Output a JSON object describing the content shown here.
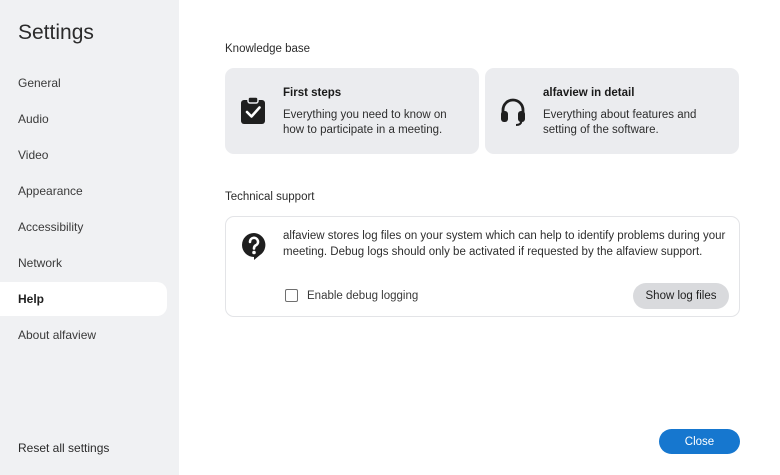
{
  "sidebar": {
    "title": "Settings",
    "items": [
      {
        "label": "General"
      },
      {
        "label": "Audio"
      },
      {
        "label": "Video"
      },
      {
        "label": "Appearance"
      },
      {
        "label": "Accessibility"
      },
      {
        "label": "Network"
      },
      {
        "label": "Help",
        "active": true
      },
      {
        "label": "About alfaview"
      }
    ],
    "reset_label": "Reset all settings"
  },
  "knowledge_base": {
    "heading": "Knowledge base",
    "cards": [
      {
        "icon": "clipboard-check-icon",
        "title": "First steps",
        "description": "Everything you need to know on how to participate in a meeting."
      },
      {
        "icon": "headset-icon",
        "title": "alfaview in detail",
        "description": "Everything about features and setting of the software."
      }
    ]
  },
  "technical_support": {
    "heading": "Technical support",
    "icon": "question-bubble-icon",
    "description": "alfaview stores log files on your system which can help to identify problems during your meeting. Debug logs should only be activated if requested by the alfaview support.",
    "debug_label": "Enable debug logging",
    "debug_checked": false,
    "show_logs_label": "Show log files"
  },
  "footer": {
    "close_label": "Close"
  },
  "colors": {
    "accent": "#1677cf",
    "sidebar_bg": "#f0f1f3",
    "card_bg": "#ebecef"
  }
}
